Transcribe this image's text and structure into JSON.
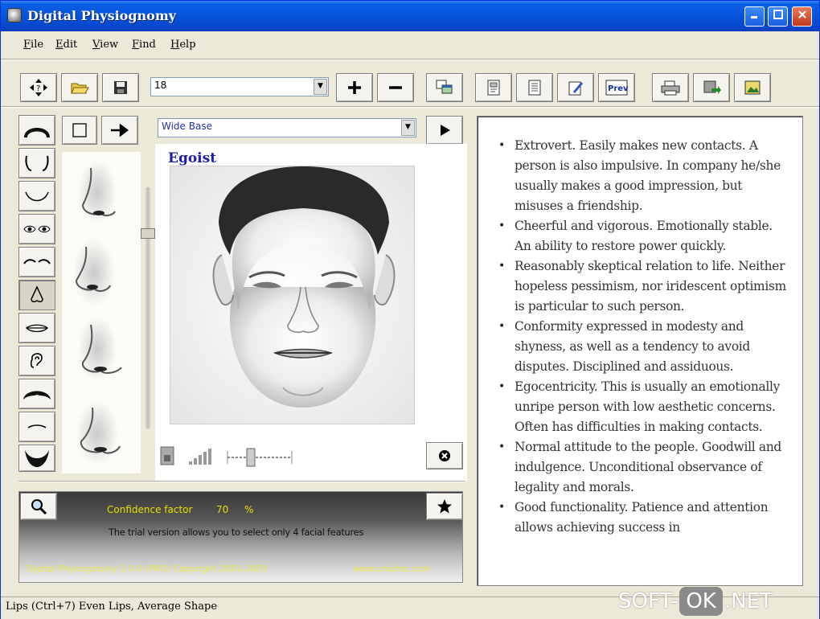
{
  "window": {
    "title": "Digital Physiognomy"
  },
  "menu": [
    "File",
    "Edit",
    "View",
    "Find",
    "Help"
  ],
  "toolbar": {
    "size_value": "18"
  },
  "feature_select": {
    "value": "Wide Base"
  },
  "portrait": {
    "type_label": "Egoist"
  },
  "description": [
    "Extrovert. Easily makes new contacts. A person is also impulsive. In company he/she usually makes a good impression, but misuses a friendship.",
    "Cheerful and vigorous. Emotionally stable. An ability to restore power quickly.",
    "Reasonably skeptical relation to life. Neither hopeless pessimism, nor iridescent optimism is particular to such person.",
    "Conformity expressed in modesty and shyness, as well as a tendency to avoid disputes. Disciplined and assiduous.",
    "Egocentricity. This is usually an emotionally unripe person with low aesthetic concerns. Often has difficulties in making contacts.",
    "Normal attitude to the people. Goodwill and indulgence. Unconditional observance of legality and morals.",
    "Good functionality. Patience and attention allows achieving success in"
  ],
  "bottom": {
    "confidence_label": "Confidence factor",
    "confidence_value": "70",
    "confidence_unit": "%",
    "trial_notice": "The trial version allows you to select only 4 facial features",
    "footer_left": "Digital Physiognomy 2.0.0 (PRO) Copyright 2001-2003",
    "footer_right": "www.uniphiz.com"
  },
  "status": {
    "text": "Lips (Ctrl+7) Even Lips, Average Shape"
  },
  "watermark": {
    "left": "SOFT-",
    "middle": "OK",
    "right": ".NET"
  },
  "colors": {
    "titlebar": "#0754dc",
    "egoist_label": "#1c1cb4",
    "confidence_text": "#e8e000",
    "window_bg": "#ece9d8"
  }
}
